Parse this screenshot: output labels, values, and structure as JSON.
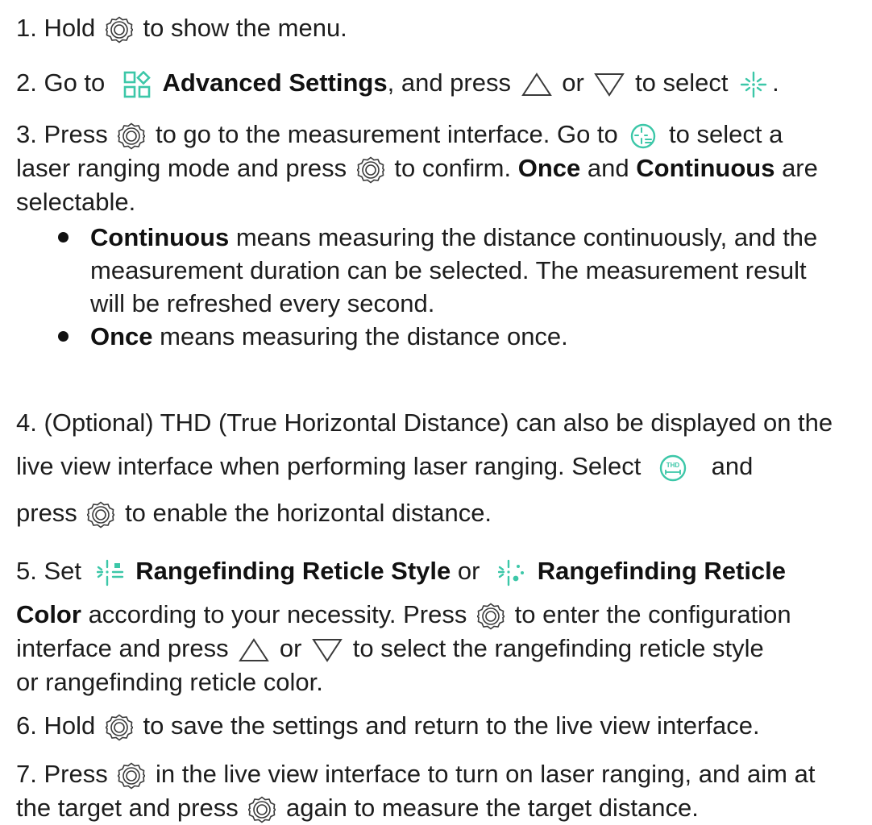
{
  "steps": {
    "s1": {
      "num": "1. Hold",
      "text": "to show the menu."
    },
    "s2": {
      "num": "2. Go to",
      "label": "Advanced Settings",
      "comma": ", and press",
      "or": "or",
      "text": "to select",
      "end": "."
    },
    "s3": {
      "num": "3. Press",
      "text_a": "to go to the measurement interface. Go to",
      "text_b": "to select a",
      "text_c": "laser ranging mode and press",
      "text_d": "to confirm.",
      "once": "Once",
      "and": "and",
      "continuous": "Continuous",
      "are": "are",
      "selectable": "selectable.",
      "bullets": [
        {
          "bold": "Continuous",
          "text": "means measuring the distance continuously, and the measurement duration can be selected. The measurement result will be refreshed every second."
        },
        {
          "bold": "Once",
          "text": "means measuring the distance once."
        }
      ]
    },
    "s4": {
      "line1": "4. (Optional) THD (True Horizontal Distance) can also be displayed on the",
      "line2a": "live view interface when performing laser ranging. Select",
      "line2b": "and",
      "line3a": "press",
      "line3b": "to enable the horizontal distance."
    },
    "s5": {
      "num": "5. Set",
      "label1": "Rangefinding Reticle Style",
      "or": "or",
      "label2a": "Rangefinding Reticle",
      "label2b": "Color",
      "text_a": "according to your necessity. Press",
      "text_b": "to enter the configuration",
      "text_c": "interface and press",
      "or2": "or",
      "text_d": "to select the rangefinding reticle style",
      "text_e": "or rangefinding reticle color."
    },
    "s6": {
      "num": "6. Hold",
      "text": "to save the settings and return to the live view interface."
    },
    "s7": {
      "num": "7. Press",
      "text_a": "in the live view interface to turn on laser ranging, and aim at",
      "text_b": "the target and press",
      "text_c": "again to measure the target distance."
    }
  },
  "icons": {
    "button": "focus-wheel-button-icon",
    "up": "up-triangle-icon",
    "down": "down-triangle-icon",
    "settings": "advanced-settings-icon",
    "laser": "laser-ranging-icon",
    "laser_mode": "laser-mode-icon",
    "thd": "thd-icon",
    "reticle_style": "reticle-style-icon",
    "reticle_color": "reticle-color-icon"
  },
  "colors": {
    "accent": "#3cc7a8",
    "text": "#1d1d1d"
  }
}
